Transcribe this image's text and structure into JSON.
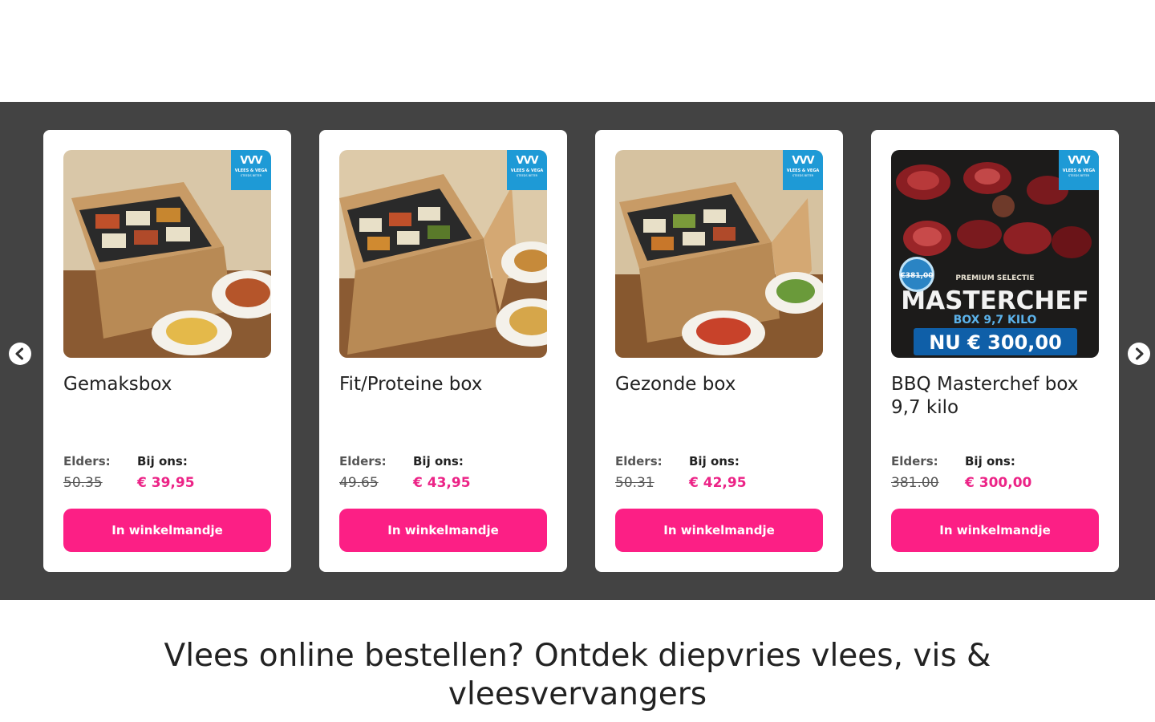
{
  "colors": {
    "band": "#434343",
    "accent": "#fc1f85",
    "price": "#ec2487",
    "badge": "#1e9ad6"
  },
  "carousel": {
    "prev_icon": "chevron-left-icon",
    "next_icon": "chevron-right-icon",
    "products": [
      {
        "title": "Gemaksbox",
        "elders_label": "Elders:",
        "elders_price": "50.35",
        "ons_label": "Bij ons:",
        "ons_price": "€ 39,95",
        "button": "In winkelmandje",
        "image": "meal-box-photo",
        "badge": {
          "logo": "VVV",
          "name": "VLEES & VEGA",
          "sub": "STEEDS BETER"
        }
      },
      {
        "title": "Fit/Proteine box",
        "elders_label": "Elders:",
        "elders_price": "49.65",
        "ons_label": "Bij ons:",
        "ons_price": "€ 43,95",
        "button": "In winkelmandje",
        "image": "meal-box-photo",
        "badge": {
          "logo": "VVV",
          "name": "VLEES & VEGA",
          "sub": "STEEDS BETER"
        }
      },
      {
        "title": "Gezonde box",
        "elders_label": "Elders:",
        "elders_price": "50.31",
        "ons_label": "Bij ons:",
        "ons_price": "€ 42,95",
        "button": "In winkelmandje",
        "image": "meal-box-photo",
        "badge": {
          "logo": "VVV",
          "name": "VLEES & VEGA",
          "sub": "STEEDS BETER"
        }
      },
      {
        "title": "BBQ Masterchef box 9,7 kilo",
        "elders_label": "Elders:",
        "elders_price": "381.00",
        "ons_label": "Bij ons:",
        "ons_price": "€ 300,00",
        "button": "In winkelmandje",
        "image": "bbq-meat-photo",
        "badge": {
          "logo": "VVV",
          "name": "VLEES & VEGA",
          "sub": "STEEDS BETER"
        },
        "promo": {
          "old": "€381,00",
          "top": "PREMIUM SELECTIE",
          "title": "MASTERCHEF",
          "sub": "BOX 9,7 KILO",
          "now": "NU € 300,00"
        }
      }
    ]
  },
  "heading": "Vlees online bestellen? Ontdek diepvries vlees, vis & vleesvervangers"
}
